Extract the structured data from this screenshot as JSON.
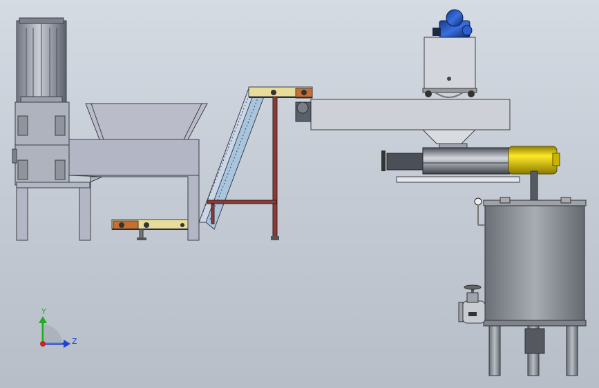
{
  "app": {
    "view": "Front",
    "background_top": "#d5dbe3",
    "background_bottom": "#b7bec8"
  },
  "triad": {
    "x_label": "",
    "y_label": "Y",
    "z_label": "Z",
    "y_color": "#22aa22",
    "z_color": "#2244cc",
    "origin_color": "#cc2222"
  },
  "model": {
    "components": [
      "shredder-motor",
      "hopper",
      "shredder-frame",
      "feed-belt-conveyor",
      "inclined-conveyor",
      "screw-conveyor-housing",
      "vacuum-pump-unit",
      "extruder-barrel",
      "mixing-tank",
      "tank-drain-valve"
    ],
    "colors": {
      "steel": "#a9aeb8",
      "frame": "#b3b6c4",
      "belt": "#e8dc9a",
      "accent_orange": "#c86f2f",
      "accent_yellow": "#e6d100",
      "motor_blue": "#1f4fb8",
      "tank": "#8d9198",
      "red_frame": "#8c3a36"
    }
  }
}
